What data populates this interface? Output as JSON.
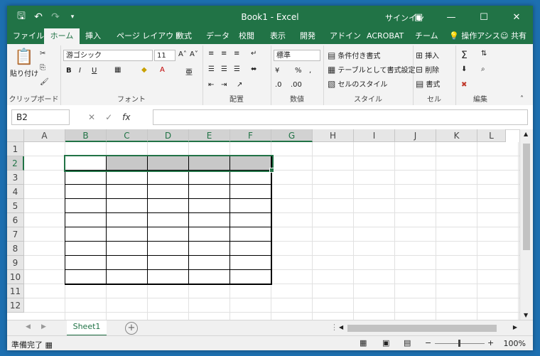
{
  "title_bar": {
    "title": "Book1  -  Excel",
    "signin": "サインイン",
    "qat_icons": [
      "save-icon",
      "undo-icon",
      "redo-icon",
      "customize-qat-icon"
    ],
    "window_buttons": [
      "ribbon-display-icon",
      "minimize-icon",
      "maximize-icon",
      "close-icon"
    ]
  },
  "tabs": [
    "ファイル",
    "ホーム",
    "挿入",
    "ページ レイアウト",
    "数式",
    "データ",
    "校閲",
    "表示",
    "開発",
    "アドイン",
    "ACROBAT",
    "チーム"
  ],
  "active_tab": "ホーム",
  "tell_me": "操作アシス",
  "share": "共有",
  "ribbon": {
    "clipboard": {
      "label": "クリップボード",
      "paste": "貼り付け"
    },
    "font": {
      "label": "フォント",
      "family": "游ゴシック",
      "size": "11",
      "bold": "B",
      "italic": "I",
      "underline": "U"
    },
    "alignment": {
      "label": "配置"
    },
    "number": {
      "label": "数値",
      "format": "標準"
    },
    "styles": {
      "label": "スタイル",
      "conditional": "条件付き書式",
      "as_table": "テーブルとして書式設定",
      "cell_styles": "セルのスタイル"
    },
    "cells": {
      "label": "セル",
      "insert": "挿入",
      "delete": "削除",
      "format": "書式"
    },
    "editing": {
      "label": "編集"
    }
  },
  "formula_bar": {
    "name_box": "B2",
    "formula": ""
  },
  "columns": [
    "A",
    "B",
    "C",
    "D",
    "E",
    "F",
    "G",
    "H",
    "I",
    "J",
    "K",
    "L"
  ],
  "rows": [
    "1",
    "2",
    "3",
    "4",
    "5",
    "6",
    "7",
    "8",
    "9",
    "10",
    "11",
    "12"
  ],
  "selection": {
    "range": "B2:G2",
    "active_cell": "B2"
  },
  "sheet_tabs": [
    "Sheet1"
  ],
  "status_bar": {
    "status": "準備完了",
    "zoom": "100%"
  },
  "colors": {
    "excel_green": "#217346",
    "header_fill": "#c8c8c8",
    "border": "#000000"
  }
}
